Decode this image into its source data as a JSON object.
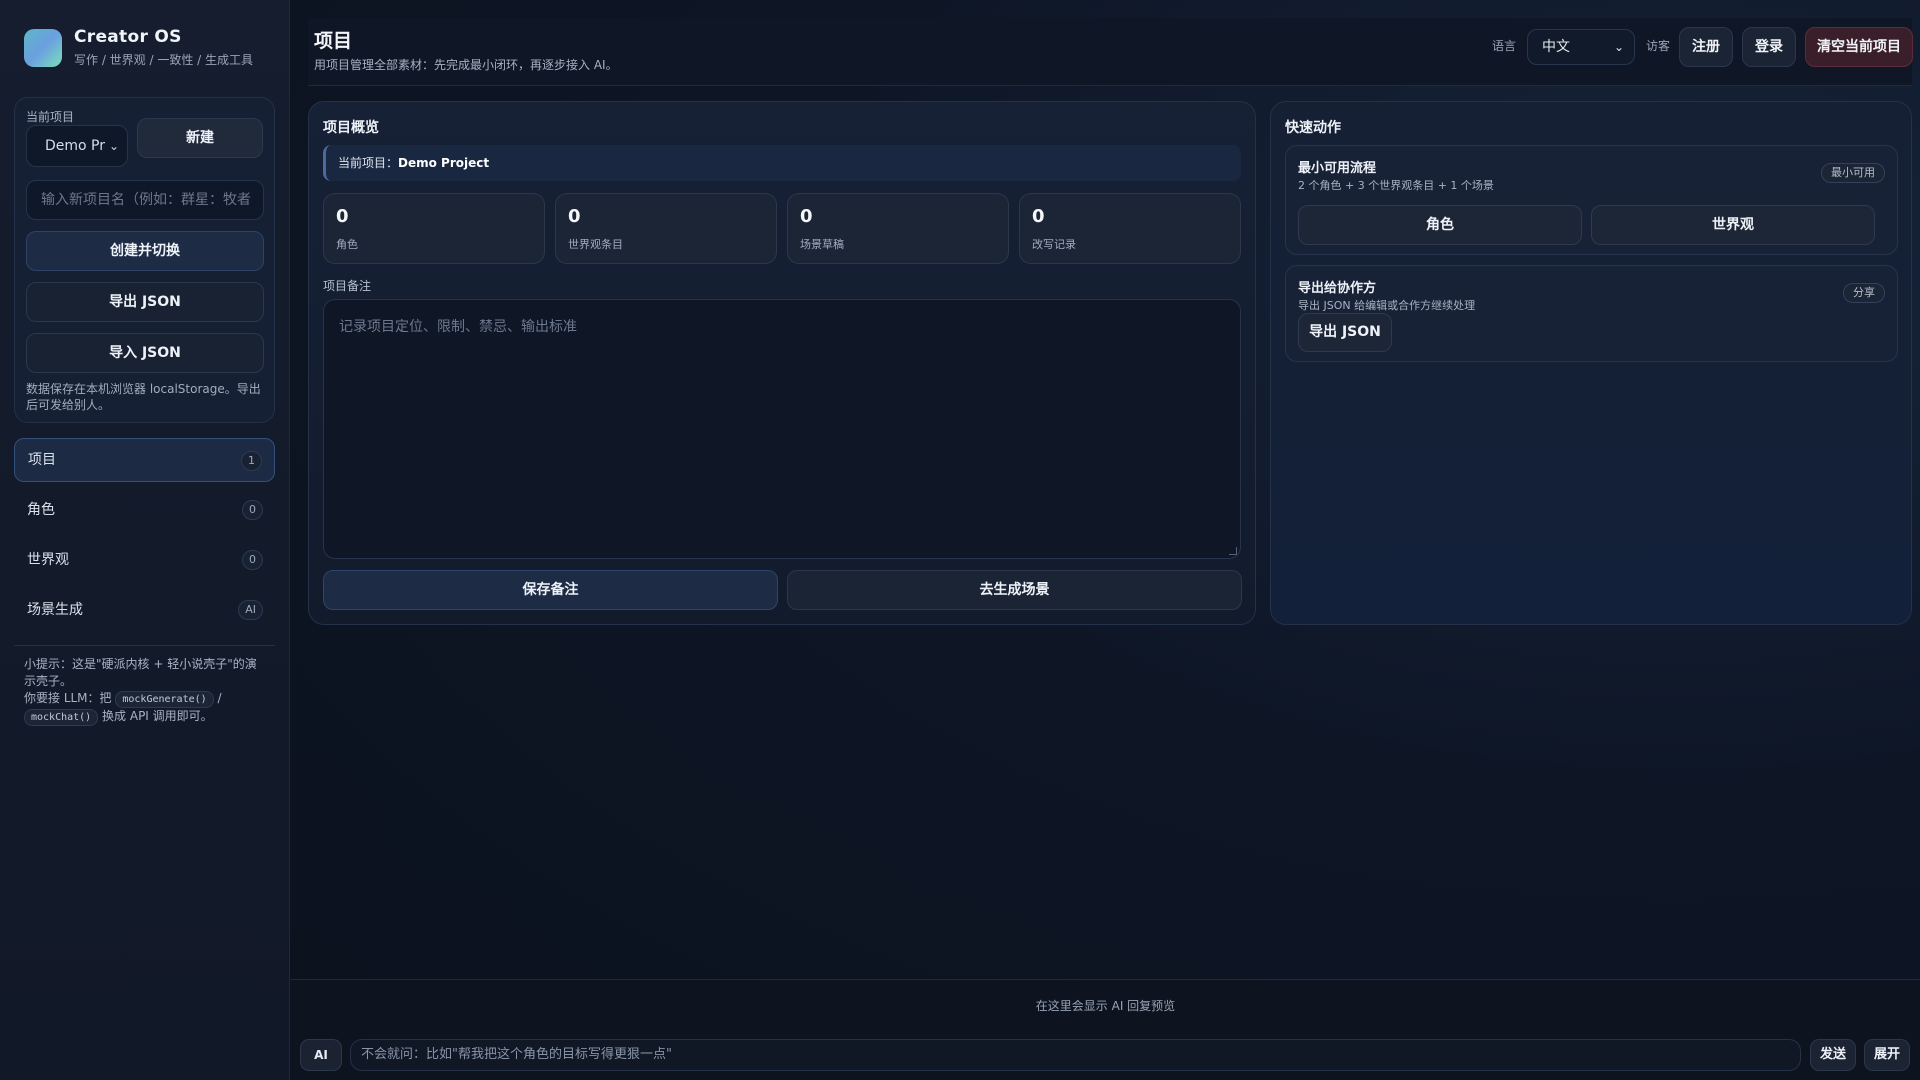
{
  "brand": {
    "title": "Creator OS",
    "subtitle": "写作 / 世界观 / 一致性 / 生成工具"
  },
  "sidebar": {
    "project_label": "当前项目",
    "project_select_value": "Demo Pr",
    "new_button": "新建",
    "new_project_placeholder": "输入新项目名（例如：群星：牧者",
    "create_switch_button": "创建并切换",
    "export_json_button": "导出 JSON",
    "import_json_button": "导入 JSON",
    "storage_note": "数据保存在本机浏览器 localStorage。导出后可发给别人。",
    "nav": [
      {
        "label": "项目",
        "badge": "1",
        "active": true
      },
      {
        "label": "角色",
        "badge": "0",
        "active": false
      },
      {
        "label": "世界观",
        "badge": "0",
        "active": false
      },
      {
        "label": "场景生成",
        "badge": "AI",
        "active": false
      }
    ],
    "tip_line1": "小提示：这是\"硬派内核 + 轻小说壳子\"的演示壳子。",
    "tip_line2_prefix": "你要接 LLM：把",
    "tip_code1": "mockGenerate()",
    "tip_sep": "/",
    "tip_code2": "mockChat()",
    "tip_line2_suffix": "换成 API 调用即可。"
  },
  "header": {
    "title": "项目",
    "subtitle": "用项目管理全部素材：先完成最小闭环，再逐步接入 AI。",
    "language_label": "语言",
    "language_value": "中文",
    "guest_label": "访客",
    "register_button": "注册",
    "login_button": "登录",
    "clear_button": "清空当前项目"
  },
  "overview": {
    "title": "项目概览",
    "current_project_prefix": "当前项目：",
    "current_project_name": "Demo Project",
    "stats": [
      {
        "value": "0",
        "label": "角色"
      },
      {
        "value": "0",
        "label": "世界观条目"
      },
      {
        "value": "0",
        "label": "场景草稿"
      },
      {
        "value": "0",
        "label": "改写记录"
      }
    ],
    "notes_label": "项目备注",
    "notes_placeholder": "记录项目定位、限制、禁忌、输出标准",
    "save_button": "保存备注",
    "scene_button": "去生成场景"
  },
  "quick": {
    "title": "快速动作",
    "card1": {
      "title": "最小可用流程",
      "desc": "2 个角色 + 3 个世界观条目 + 1 个场景",
      "tag": "最小可用",
      "btn_role": "角色",
      "btn_world": "世界观"
    },
    "card2": {
      "title": "导出给协作方",
      "desc": "导出 JSON 给编辑或合作方继续处理",
      "tag": "分享",
      "btn_export": "导出 JSON"
    }
  },
  "ai_bar": {
    "preview": "在这里会显示 AI 回复预览",
    "tag": "AI",
    "input_placeholder": "不会就问：比如\"帮我把这个角色的目标写得更狠一点\"",
    "send_button": "发送",
    "expand_button": "展开"
  }
}
